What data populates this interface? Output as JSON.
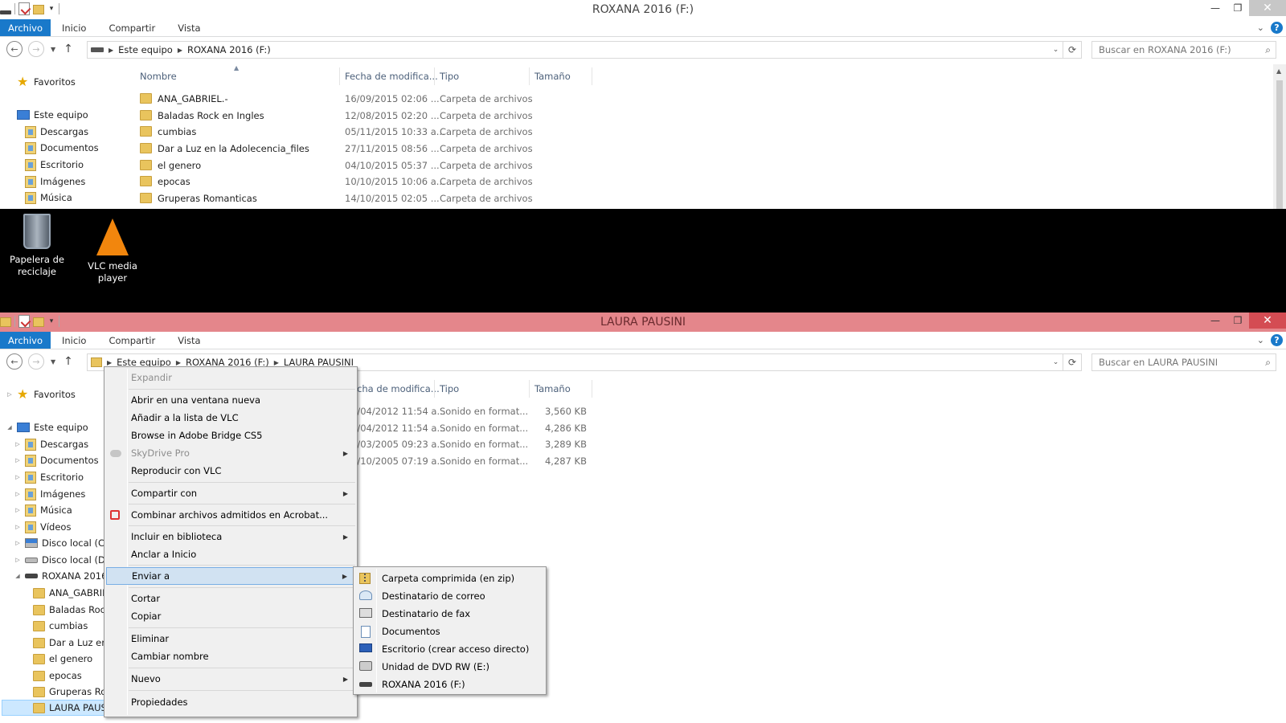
{
  "desktop": {
    "icons": [
      {
        "label": "Papelera de reciclaje"
      },
      {
        "label": "VLC media player"
      }
    ]
  },
  "window1": {
    "title": "ROXANA 2016 (F:)",
    "tabs": {
      "file": "Archivo",
      "home": "Inicio",
      "share": "Compartir",
      "view": "Vista"
    },
    "breadcrumbs": [
      "Este equipo",
      "ROXANA 2016 (F:)"
    ],
    "search_placeholder": "Buscar en ROXANA 2016 (F:)",
    "nav": {
      "favorites": "Favoritos",
      "this_pc": "Este equipo",
      "items": [
        "Descargas",
        "Documentos",
        "Escritorio",
        "Imágenes",
        "Música"
      ]
    },
    "columns": {
      "name": "Nombre",
      "date": "Fecha de modifica...",
      "type": "Tipo",
      "size": "Tamaño"
    },
    "rows": [
      {
        "name": "ANA_GABRIEL.-",
        "date": "16/09/2015 02:06 ...",
        "type": "Carpeta de archivos"
      },
      {
        "name": "Baladas Rock en Ingles",
        "date": "12/08/2015 02:20 ...",
        "type": "Carpeta de archivos"
      },
      {
        "name": "cumbias",
        "date": "05/11/2015 10:33 a...",
        "type": "Carpeta de archivos"
      },
      {
        "name": "Dar a Luz en la Adolecencia_files",
        "date": "27/11/2015 08:56 ...",
        "type": "Carpeta de archivos"
      },
      {
        "name": "el genero",
        "date": "04/10/2015 05:37 ...",
        "type": "Carpeta de archivos"
      },
      {
        "name": "epocas",
        "date": "10/10/2015 10:06 a...",
        "type": "Carpeta de archivos"
      },
      {
        "name": "Gruperas Romanticas",
        "date": "14/10/2015 02:05 ...",
        "type": "Carpeta de archivos"
      }
    ]
  },
  "window2": {
    "title": "LAURA PAUSINI",
    "tabs": {
      "file": "Archivo",
      "home": "Inicio",
      "share": "Compartir",
      "view": "Vista"
    },
    "breadcrumbs": [
      "Este equipo",
      "ROXANA 2016 (F:)",
      "LAURA PAUSINI"
    ],
    "search_placeholder": "Buscar en LAURA PAUSINI",
    "nav": {
      "favorites": "Favoritos",
      "this_pc": "Este equipo",
      "items": [
        "Descargas",
        "Documentos",
        "Escritorio",
        "Imágenes",
        "Música",
        "Vídeos",
        "Disco local (C:)",
        "Disco local (D:)",
        "ROXANA 2016"
      ],
      "sub_items": [
        "ANA_GABRIE",
        "Baladas Rock",
        "cumbias",
        "Dar a Luz en",
        "el genero",
        "epocas",
        "Gruperas Ror",
        "LAURA PAUSINI"
      ]
    },
    "columns": {
      "date": "echa de modifica...",
      "type": "Tipo",
      "size": "Tamaño"
    },
    "rows": [
      {
        "date": "7/04/2012 11:54 a...",
        "type": "Sonido en format...",
        "size": "3,560 KB"
      },
      {
        "date": "7/04/2012 11:54 a...",
        "type": "Sonido en format...",
        "size": "4,286 KB"
      },
      {
        "date": "8/03/2005 09:23 a...",
        "type": "Sonido en format...",
        "size": "3,289 KB"
      },
      {
        "date": "9/10/2005 07:19 a...",
        "type": "Sonido en format...",
        "size": "4,287 KB"
      }
    ]
  },
  "context_menu": {
    "expand": "Expandir",
    "open_new_window": "Abrir en una ventana nueva",
    "add_vlc": "Añadir a la lista de VLC",
    "browse_bridge": "Browse in Adobe Bridge CS5",
    "skydrive": "SkyDrive Pro",
    "play_vlc": "Reproducir con VLC",
    "share_with": "Compartir con",
    "combine_acrobat": "Combinar archivos admitidos en Acrobat...",
    "include_library": "Incluir en biblioteca",
    "pin_start": "Anclar a Inicio",
    "send_to": "Enviar a",
    "cut": "Cortar",
    "copy": "Copiar",
    "delete": "Eliminar",
    "rename": "Cambiar nombre",
    "new": "Nuevo",
    "properties": "Propiedades"
  },
  "send_to_menu": {
    "zip": "Carpeta comprimida (en zip)",
    "mail": "Destinatario de correo",
    "fax": "Destinatario de fax",
    "documents": "Documentos",
    "desktop": "Escritorio (crear acceso directo)",
    "dvd": "Unidad de DVD RW (E:)",
    "roxana": "ROXANA 2016 (F:)"
  }
}
